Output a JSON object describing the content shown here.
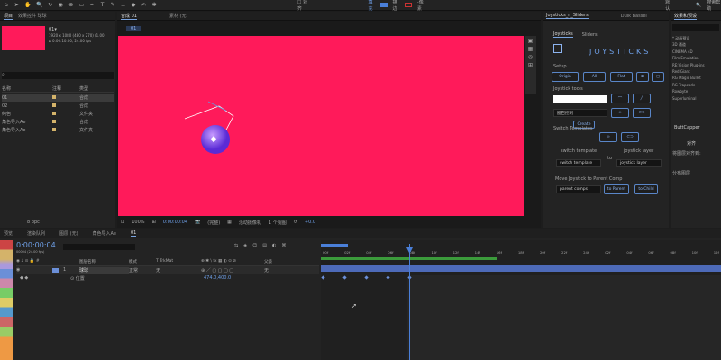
{
  "topbar": {
    "snap_label": "对齐",
    "fill_label": "填充",
    "stroke_label": "描边",
    "stroke_px": "-像素",
    "workspace": "默认",
    "search": "搜索帮助"
  },
  "project": {
    "tab": "项目",
    "effects_tab": "效果控件 球球",
    "item_name": "01▾",
    "item_info1": "1920 x 1080  (480 x 270) (1.00)",
    "item_info2": "Δ 0:00:10:00, 24.00 fps",
    "col_name": "名称",
    "col_label": "注释",
    "col_type": "类型",
    "rows": [
      {
        "name": "01",
        "type": "合成",
        "color": "#d4b36a"
      },
      {
        "name": "02",
        "type": "合成",
        "color": "#d4b36a"
      },
      {
        "name": "纯色",
        "type": "文件夹",
        "color": "#d4b36a"
      },
      {
        "name": "角色导入Ae",
        "type": "合成",
        "color": "#d4b36a"
      },
      {
        "name": "角色导入Ae",
        "type": "文件夹",
        "color": "#d4b36a"
      }
    ],
    "bpc": "8 bpc"
  },
  "comp": {
    "tab": "合成 01",
    "layer_tab": "素材 (无)",
    "breadcrumb": "01",
    "zoom": "100%",
    "timecode": "0:00:00:04",
    "quality": "(完整)",
    "camera": "活动摄像机",
    "views": "1 个视图",
    "exposure": "+0.0",
    "bg": "#ff1a5a"
  },
  "joystick": {
    "tab": "Joysticks_n_Sliders",
    "tab2": "Duik Bassel",
    "sub1": "Joysticks",
    "sub2": "Sliders",
    "logo": "JOYSTICKS",
    "setup": "Setup",
    "origin": "Origin",
    "all": "All",
    "flat": "Flat",
    "tools": "Joystick tools",
    "ctrl_label": "圈巴控制",
    "create": "Create",
    "switch_templates": "Switch Templates",
    "switch_template": "switch template",
    "to": "to",
    "joystick_layer": "joystick layer",
    "switch_sel": "switch template",
    "layer_sel": "joystick layer",
    "move": "Move Joystick to Parent Comp",
    "parent_sel": "parent comps",
    "to_parent": "to Parent",
    "to_child": "to Child"
  },
  "effects": {
    "tab": "效果和预设",
    "items": [
      "* 动画预设",
      "3D 通道",
      "CINEMA 4D",
      "Film Emulation",
      "RE:Vision Plug-ins",
      "Red Giant",
      "RG Magic Bullet",
      "RG Trapcode",
      "Rowbyte",
      "Superluminal"
    ],
    "butt": "ButtCapper",
    "align_tab": "对齐",
    "align_to": "将图层对齐到:",
    "distribute": "分布图层"
  },
  "timeline": {
    "tabs": [
      "预览",
      "渲染队列",
      "图层 (无)",
      "角色导入Ae",
      "01"
    ],
    "timecode": "0:00:00:04",
    "fps": "00004 (24.00 fps)",
    "cols": {
      "name": "图层名称",
      "mode": "模式",
      "trkmat": "T TrkMat",
      "parent": "父级"
    },
    "layer": {
      "num": "1",
      "name": "球球",
      "mode": "正常",
      "trk": "无",
      "parent": "无"
    },
    "prop": {
      "name": "位置",
      "value": "474.0,400.0"
    },
    "ruler": [
      "00f",
      "02f",
      "04f",
      "06f",
      "08f",
      "10f",
      "12f",
      "14f",
      "16f",
      "18f",
      "20f",
      "22f",
      "24f",
      "02f",
      "04f",
      "06f",
      "08f",
      "10f",
      "12f"
    ]
  }
}
